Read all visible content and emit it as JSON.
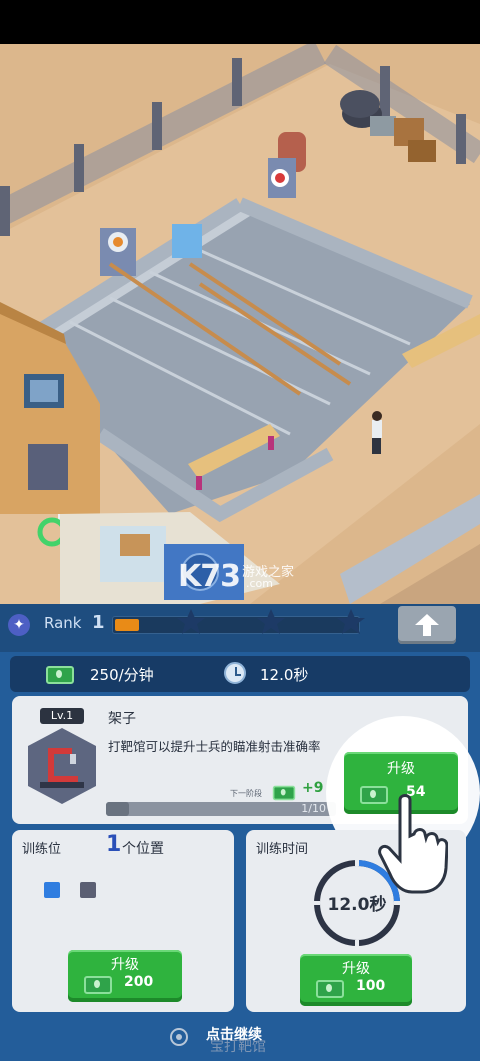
{
  "watermark": {
    "brand": "K73",
    "site_cn": "游戏之家",
    "site_domain": ".com"
  },
  "rank": {
    "label": "Rank",
    "value": "1",
    "progress": 0.1,
    "stars": 3
  },
  "rates": {
    "income": "250/分钟",
    "time": "12.0秒"
  },
  "item": {
    "level": "Lv.1",
    "name": "架子",
    "description": "打靶馆可以提升士兵的瞄准射击准确率",
    "next_stage_label": "下一阶段",
    "next_stage_bonus": "+9",
    "progress_text": "1/10",
    "progress": 0.1,
    "upgrade_label": "升级",
    "upgrade_cost": "54"
  },
  "slots": {
    "title": "训练位",
    "count": "1",
    "unit": "个位置",
    "upgrade_label": "升级",
    "upgrade_cost": "200"
  },
  "training_time": {
    "title": "训练时间",
    "value": "12.0秒",
    "upgrade_label": "升级",
    "upgrade_cost": "100"
  },
  "footer": {
    "continue_label": "点击继续",
    "ghost_text": "宝打靶馆"
  },
  "colors": {
    "panel": "#235d9a",
    "accent_green": "#2fb33e",
    "xp_orange": "#e98b17"
  }
}
